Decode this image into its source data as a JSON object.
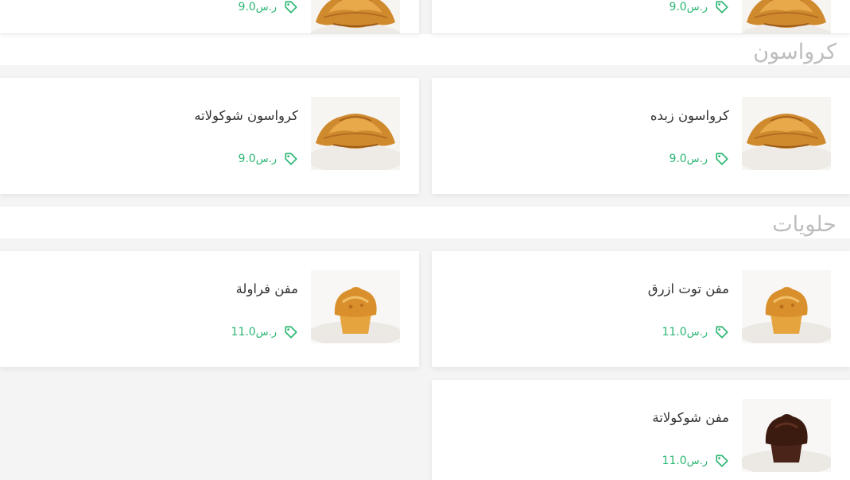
{
  "currency": "ر.س",
  "top_partial": [
    {
      "price": "9.0"
    },
    {
      "price": "9.0"
    }
  ],
  "sections": [
    {
      "title": "كرواسون",
      "items": [
        {
          "name": "كرواسون زبده",
          "price": "9.0",
          "image": "croissant"
        },
        {
          "name": "كرواسون شوكولاته",
          "price": "9.0",
          "image": "croissant"
        }
      ]
    },
    {
      "title": "حلويات",
      "items": [
        {
          "name": "مفن توت ازرق",
          "price": "11.0",
          "image": "muffin-golden"
        },
        {
          "name": "مفن فراولة",
          "price": "11.0",
          "image": "muffin-golden"
        },
        {
          "name": "مفن شوكولاتة",
          "price": "11.0",
          "image": "muffin-chocolate"
        }
      ]
    }
  ],
  "colors": {
    "price": "#2bb673",
    "title": "#bdbdbd",
    "text": "#333333"
  }
}
